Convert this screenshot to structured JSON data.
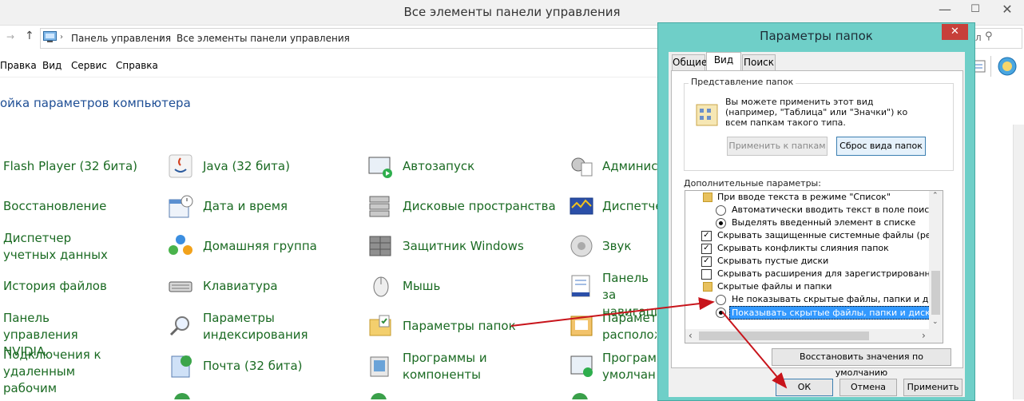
{
  "window": {
    "title": "Все элементы панели управления",
    "controls": [
      "—",
      "☐",
      "✕"
    ]
  },
  "address": {
    "segments": [
      "Панель управления",
      "Все элементы панели управления"
    ],
    "search_hint": "л"
  },
  "menu": [
    "Правка",
    "Вид",
    "Сервис",
    "Справка"
  ],
  "heading": "ойка параметров компьютера",
  "items": [
    [
      "Flash Player (32 бита)",
      "Java (32 бита)",
      "Автозапуск",
      "Админист"
    ],
    [
      "Восстановление",
      "Дата и время",
      "Дисковые пространства",
      "Диспетче"
    ],
    [
      "Диспетчер учетных данных",
      "Домашняя группа",
      "Защитник Windows",
      "Звук"
    ],
    [
      "История файлов",
      "Клавиатура",
      "Мышь",
      "Панель за навигаци"
    ],
    [
      "Панель управления NVIDIA",
      "Параметры индексирования",
      "Параметры папок",
      "Параметр расположе"
    ],
    [
      "Подключения к удаленным рабочим",
      "Почта (32 бита)",
      "Программы и компоненты",
      "Программ умолчани"
    ]
  ],
  "dialog": {
    "title": "Параметры папок",
    "close": "✕",
    "tabs": [
      "Общие",
      "Вид",
      "Поиск"
    ],
    "group_title": "Представление папок",
    "group_text": "Вы можете применить этот вид (например, \"Таблица\" или \"Значки\") ко всем папкам такого типа.",
    "apply_to_folders": "Применить к папкам",
    "reset_folders": "Сброс вида папок",
    "advanced_title": "Дополнительные параметры:",
    "tree": [
      {
        "kind": "folder",
        "text": "При вводе текста в режиме \"Список\""
      },
      {
        "kind": "radio",
        "checked": false,
        "text": "Автоматически вводить текст в поле поиска"
      },
      {
        "kind": "radio",
        "checked": true,
        "text": "Выделять введенный элемент в списке"
      },
      {
        "kind": "check",
        "checked": true,
        "text": "Скрывать защищенные системные файлы (рекомен"
      },
      {
        "kind": "check",
        "checked": true,
        "text": "Скрывать конфликты слияния папок"
      },
      {
        "kind": "check",
        "checked": true,
        "text": "Скрывать пустые диски"
      },
      {
        "kind": "check",
        "checked": false,
        "text": "Скрывать расширения для зарегистрированных типо"
      },
      {
        "kind": "folder",
        "text": "Скрытые файлы и папки"
      },
      {
        "kind": "radio",
        "checked": false,
        "text": "Не показывать скрытые файлы, папки и диски"
      },
      {
        "kind": "radio",
        "checked": true,
        "selected": true,
        "text": "Показывать скрытые файлы, папки и диски"
      }
    ],
    "restore_defaults": "Восстановить значения по умолчанию",
    "ok": "ОК",
    "cancel": "Отмена",
    "apply": "Применить"
  },
  "colors": {
    "dialog_frame": "#6fcfc8",
    "close_button": "#c7403a",
    "link_green": "#1a6a22",
    "heading_blue": "#1e4e95",
    "annotation_arrow": "#c8141b",
    "selection": "#3399ff"
  }
}
